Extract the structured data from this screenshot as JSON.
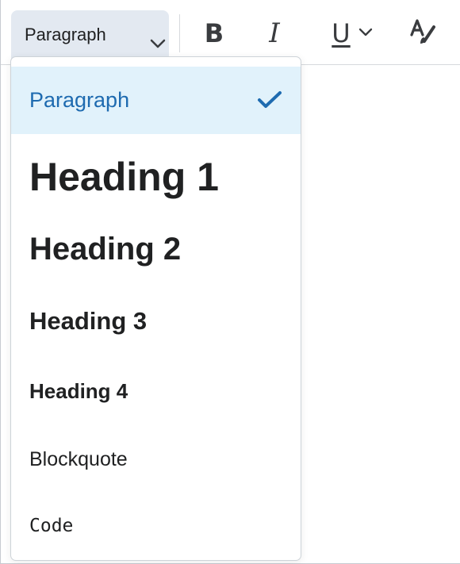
{
  "toolbar": {
    "format_select_value": "Paragraph",
    "bold_label": "B",
    "italic_label": "I",
    "underline_label": "U",
    "icons": [
      "chevron-down-icon",
      "bold-icon",
      "italic-icon",
      "underline-icon",
      "clear-format-icon"
    ]
  },
  "format_menu": {
    "items": [
      {
        "label": "Paragraph",
        "selected": true
      },
      {
        "label": "Heading 1",
        "selected": false
      },
      {
        "label": "Heading 2",
        "selected": false
      },
      {
        "label": "Heading 3",
        "selected": false
      },
      {
        "label": "Heading 4",
        "selected": false
      },
      {
        "label": "Blockquote",
        "selected": false
      },
      {
        "label": "Code",
        "selected": false
      }
    ]
  },
  "colors": {
    "selected_bg": "#e1f2fb",
    "selected_text": "#1e6bb0",
    "select_bg": "#e3e9f1"
  }
}
